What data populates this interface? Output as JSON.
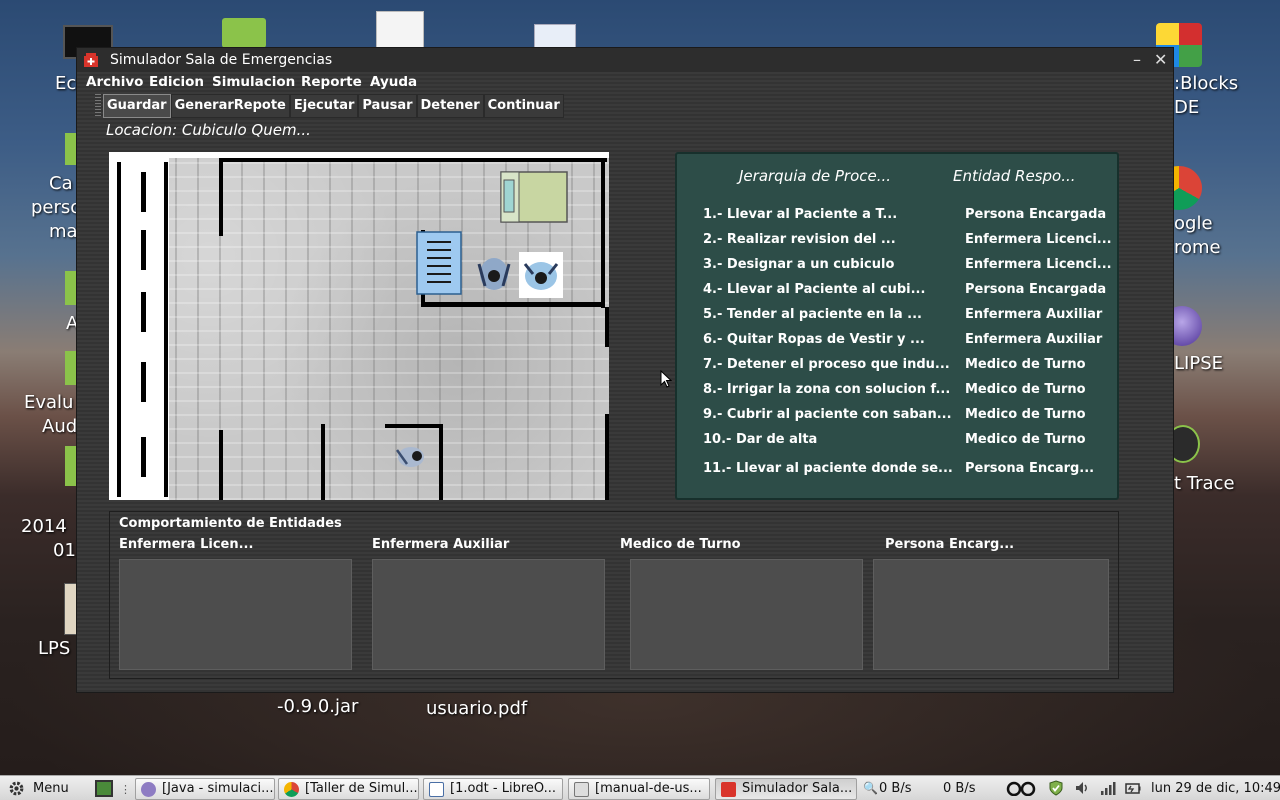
{
  "desktop": {
    "labels": [
      "Ec",
      "Ca",
      "perso",
      "ma",
      "A",
      "Evalu",
      "Aud",
      "2014",
      "01",
      "LPS",
      "-0.9.0.jar",
      "usuario.pdf",
      ":Blocks",
      "DE",
      "ogle",
      "rome",
      "LIPSE",
      "t Trace"
    ]
  },
  "window": {
    "title": "Simulador Sala de Emergencias",
    "minimize": "–",
    "close": "✕"
  },
  "menu": [
    "Archivo",
    "Edicion",
    "Simulacion",
    "Reporte",
    "Ayuda"
  ],
  "toolbar": [
    "Guardar",
    "GenerarRepote",
    "Ejecutar",
    "Pausar",
    "Detener",
    "Continuar"
  ],
  "location": "Locacion: Cubiculo Quem...",
  "process_table": {
    "headers": [
      "Jerarquia de Proce...",
      "Entidad Respo..."
    ],
    "rows": [
      {
        "task": "1.- Llevar al Paciente a T...",
        "entity": "Persona Encargada"
      },
      {
        "task": "2.- Realizar revision del ...",
        "entity": "Enfermera Licenci..."
      },
      {
        "task": "3.- Designar a un cubiculo",
        "entity": "Enfermera Licenci..."
      },
      {
        "task": "4.- Llevar al Paciente al cubi...",
        "entity": "Persona Encargada"
      },
      {
        "task": "5.- Tender al paciente en la ...",
        "entity": "Enfermera Auxiliar"
      },
      {
        "task": "6.- Quitar Ropas de Vestir y ...",
        "entity": "Enfermera Auxiliar"
      },
      {
        "task": "7.- Detener el proceso que indu...",
        "entity": "Medico de Turno"
      },
      {
        "task": "8.- Irrigar la zona con solucion f...",
        "entity": "Medico de Turno"
      },
      {
        "task": "9.- Cubrir al paciente con saban...",
        "entity": "Medico de Turno"
      },
      {
        "task": "10.- Dar de alta",
        "entity": "Medico de Turno"
      },
      {
        "task": "11.- Llevar al paciente donde se...",
        "entity": "Persona Encarg..."
      }
    ]
  },
  "behaviour": {
    "title": "Comportamiento de Entidades",
    "columns": [
      "Enfermera Licen...",
      "Enfermera Auxiliar",
      "Medico de Turno",
      "Persona Encarg..."
    ]
  },
  "taskbar": {
    "menu_label": "Menu",
    "tasks": [
      "[Java - simulaci...",
      "[Taller de Simul...",
      "[1.odt - LibreO...",
      "[manual-de-us...",
      "Simulador Sala..."
    ],
    "net_down": "0 B/s",
    "net_up": "0 B/s",
    "clock": "lun 29 de dic, 10:49"
  },
  "colors": {
    "panel_teal": "#2d4d48",
    "window_bg": "#3a3a3a",
    "title_icon_red": "#d9342b"
  }
}
